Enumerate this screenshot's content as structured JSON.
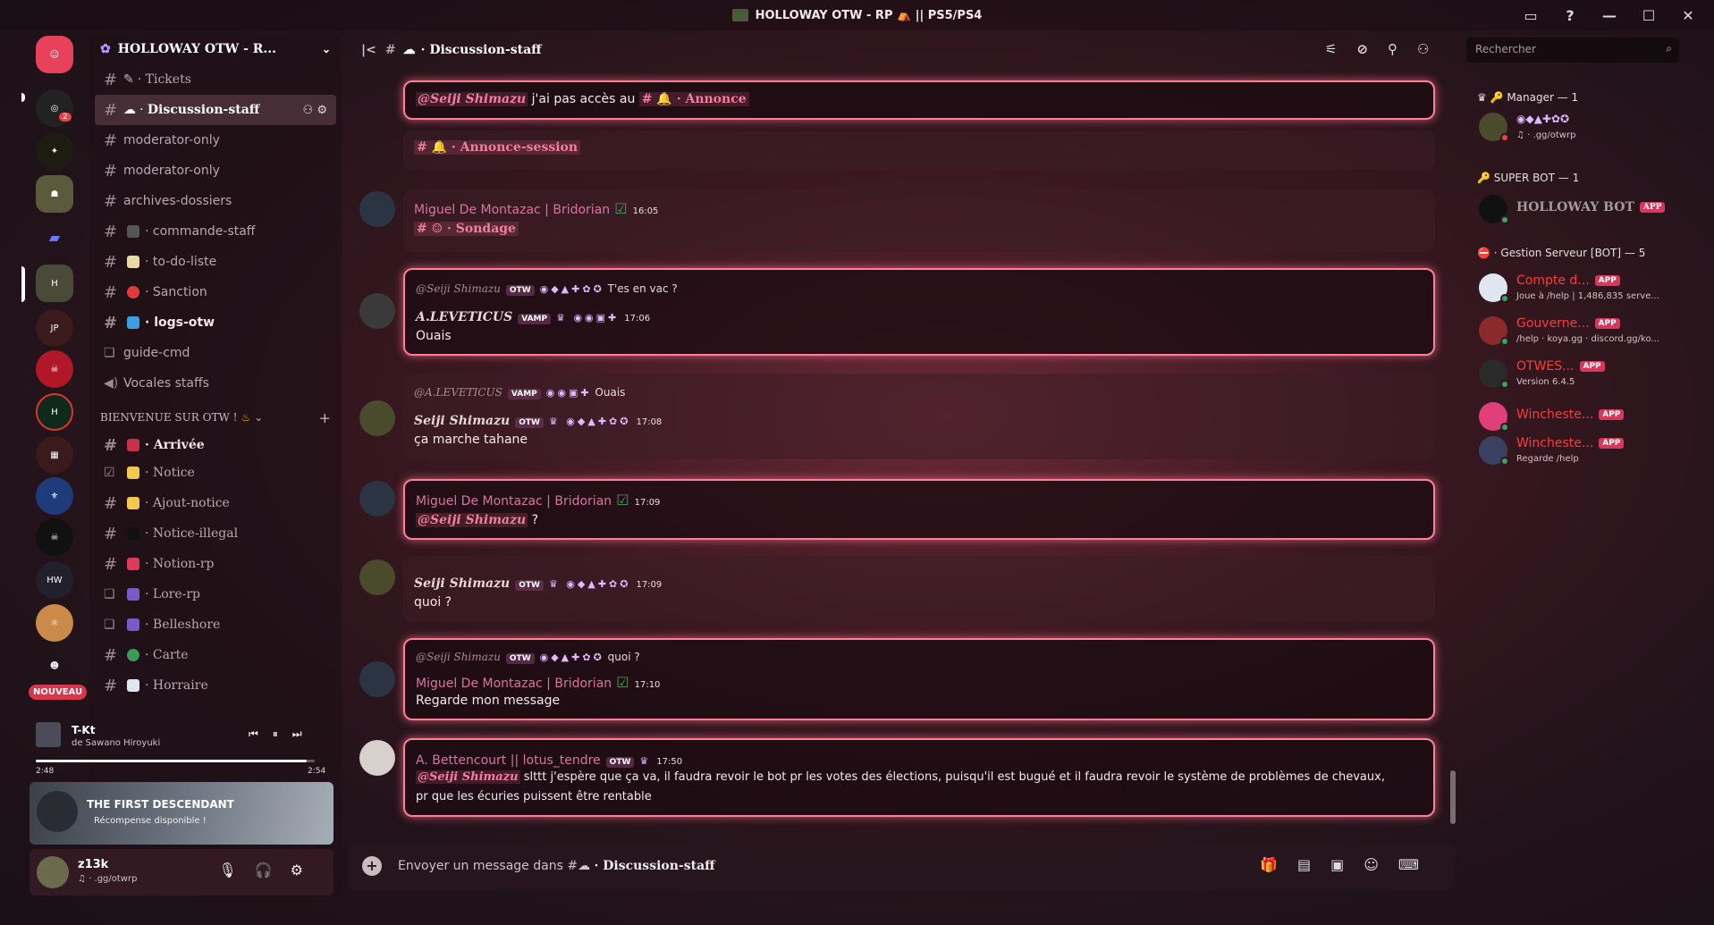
{
  "window": {
    "title": "HOLLOWAY OTW - RP ⛺ || PS5/PS4",
    "controls": [
      "▭",
      "?",
      "—",
      "☐",
      "✕"
    ]
  },
  "rail": {
    "new_badge": "NOUVEAU",
    "mention_count": "2"
  },
  "guild": {
    "name": "HOLLOWAY OTW - R...",
    "channels": [
      {
        "label": "Tickets",
        "prefix": "·",
        "type": "text"
      },
      {
        "label": "Discussion-staff",
        "prefix": "·",
        "type": "text",
        "active": true
      },
      {
        "label": "moderator-only",
        "type": "text"
      },
      {
        "label": "moderator-only",
        "type": "text"
      },
      {
        "label": "archives-dossiers",
        "type": "text"
      },
      {
        "label": "commande-staff",
        "prefix": "·",
        "type": "text"
      },
      {
        "label": "to-do-liste",
        "prefix": "·",
        "type": "text"
      },
      {
        "label": "Sanction",
        "prefix": "·",
        "type": "text"
      },
      {
        "label": "logs-otw",
        "prefix": "·",
        "type": "text",
        "unread": true
      },
      {
        "label": "guide-cmd",
        "type": "forum"
      },
      {
        "label": "Vocales staffs",
        "type": "voice"
      }
    ],
    "category": "BIENVENUE SUR OTW !",
    "welcome_channels": [
      {
        "label": "Arrivée",
        "prefix": "·",
        "unread": true
      },
      {
        "label": "Notice",
        "prefix": "·"
      },
      {
        "label": "Ajout-notice",
        "prefix": "·"
      },
      {
        "label": "Notice-illegal",
        "prefix": "·"
      },
      {
        "label": "Notion-rp",
        "prefix": "·"
      },
      {
        "label": "Lore-rp",
        "prefix": "·"
      },
      {
        "label": "Belleshore",
        "prefix": "·"
      },
      {
        "label": "Carte",
        "prefix": "·"
      },
      {
        "label": "Horraire",
        "prefix": "·"
      }
    ]
  },
  "now_playing": {
    "title": "T-Kt",
    "artist": "de Sawano Hiroyuki",
    "elapsed": "2:48",
    "duration": "2:54",
    "progress": 0.97
  },
  "promo": {
    "title": "THE FIRST DESCENDANT",
    "subtitle": "Récompense disponible !"
  },
  "user": {
    "name": "z13k",
    "status": ".gg/otwrp"
  },
  "chat": {
    "channel": "Discussion-staff",
    "search_placeholder": "Rechercher",
    "input_placeholder_prefix": "Envoyer un message dans #",
    "input_placeholder_channel": "· Discussion-staff",
    "messages": [
      {
        "type": "cont",
        "mention": "@Seiji Shimazu",
        "text": "j'ai pas accès au",
        "channel": "· Annonce"
      },
      {
        "type": "cont",
        "channel": "· Annonce-session"
      },
      {
        "author": "Miguel De Montazac | Bridorian",
        "time": "16:05",
        "channel": "· Sondage"
      },
      {
        "reply_author": "@Seiji Shimazu",
        "reply_tag": "OTW",
        "reply_text": "T'es en vac ?",
        "author": "A.LEVETICUS",
        "tag": "VAMP",
        "time": "17:06",
        "text": "Ouais"
      },
      {
        "reply_author": "@A.LEVETICUS",
        "reply_tag": "VAMP",
        "reply_text": "Ouais",
        "author": "Seiji Shimazu",
        "tag": "OTW",
        "time": "17:08",
        "text": "ça marche tahane"
      },
      {
        "author": "Miguel De Montazac | Bridorian",
        "time": "17:09",
        "mention": "@Seiji Shimazu",
        "text": "?"
      },
      {
        "author": "Seiji Shimazu",
        "tag": "OTW",
        "time": "17:09",
        "text": "quoi ?"
      },
      {
        "reply_author": "@Seiji Shimazu",
        "reply_tag": "OTW",
        "reply_text": "quoi ?",
        "author": "Miguel De Montazac | Bridorian",
        "time": "17:10",
        "text": "Regarde mon message"
      },
      {
        "author": "A. Bettencourt || lotus_tendre",
        "tag": "OTW",
        "time": "17:50",
        "mention": "@Seiji Shimazu",
        "text": "slttt j'espère que ça va, il faudra revoir le bot pr les votes des élections, puisqu'il est bugué et il faudra revoir le système de problèmes de chevaux,",
        "text2": "pr que les écuries puissent être rentable"
      }
    ]
  },
  "members": {
    "groups": [
      {
        "label": "Manager — 1"
      },
      {
        "label": "SUPER BOT — 1"
      },
      {
        "label": "· Gestion Serveur [BOT] — 5"
      }
    ],
    "manager_status": ".gg/otwrp",
    "bot": "HOLLOWAY BOT",
    "app_label": "APP",
    "bots": [
      {
        "name": "Compte d...",
        "sub": "Joue à /help | 1,486,835 serve..."
      },
      {
        "name": "Gouverne...",
        "sub": "/help · koya.gg · discord.gg/ko..."
      },
      {
        "name": "OTWES...",
        "sub": "Version 6.4.5"
      },
      {
        "name": "Wincheste...",
        "sub": ""
      },
      {
        "name": "Wincheste...",
        "sub": "Regarde /help"
      }
    ]
  },
  "colors": {
    "accent": "#ff7e98",
    "mention": "#f07fa1",
    "author_pink": "#d874a1",
    "bot_red": "#ff3a3a",
    "app_tag": "#d8365a"
  }
}
